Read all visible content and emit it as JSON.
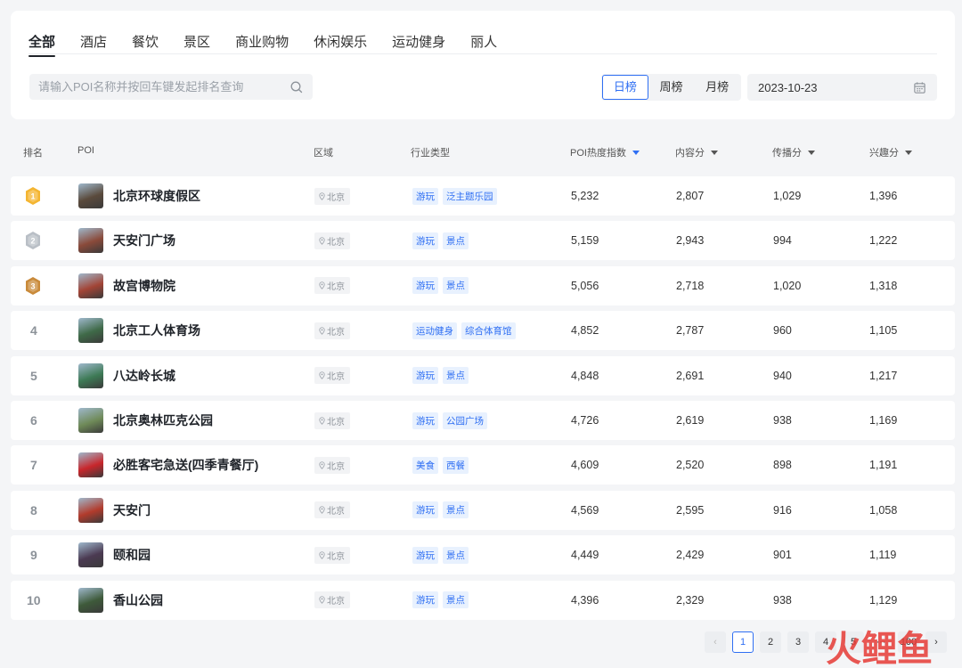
{
  "tabs": [
    {
      "label": "全部",
      "active": true
    },
    {
      "label": "酒店"
    },
    {
      "label": "餐饮"
    },
    {
      "label": "景区"
    },
    {
      "label": "商业购物"
    },
    {
      "label": "休闲娱乐"
    },
    {
      "label": "运动健身"
    },
    {
      "label": "丽人"
    }
  ],
  "search": {
    "placeholder": "请输入POI名称并按回车键发起排名查询",
    "value": ""
  },
  "period": {
    "options": [
      "日榜",
      "周榜",
      "月榜"
    ],
    "selected": "日榜"
  },
  "date": {
    "value": "2023-10-23"
  },
  "columns": {
    "rank": "排名",
    "poi": "POI",
    "region": "区域",
    "industry": "行业类型",
    "heat": "POI热度指数",
    "content": "内容分",
    "spread": "传播分",
    "interest": "兴趣分"
  },
  "sort_column": "heat",
  "rows": [
    {
      "rank": "1",
      "name": "北京环球度假区",
      "region": "北京",
      "tags": [
        "游玩",
        "泛主题乐园"
      ],
      "heat": "5,232",
      "content": "2,807",
      "spread": "1,029",
      "interest": "1,396",
      "thumb": "#5a4a3c"
    },
    {
      "rank": "2",
      "name": "天安门广场",
      "region": "北京",
      "tags": [
        "游玩",
        "景点"
      ],
      "heat": "5,159",
      "content": "2,943",
      "spread": "994",
      "interest": "1,222",
      "thumb": "#8a4a3a"
    },
    {
      "rank": "3",
      "name": "故宫博物院",
      "region": "北京",
      "tags": [
        "游玩",
        "景点"
      ],
      "heat": "5,056",
      "content": "2,718",
      "spread": "1,020",
      "interest": "1,318",
      "thumb": "#a24436"
    },
    {
      "rank": "4",
      "name": "北京工人体育场",
      "region": "北京",
      "tags": [
        "运动健身",
        "综合体育馆"
      ],
      "heat": "4,852",
      "content": "2,787",
      "spread": "960",
      "interest": "1,105",
      "thumb": "#3f6a48"
    },
    {
      "rank": "5",
      "name": "八达岭长城",
      "region": "北京",
      "tags": [
        "游玩",
        "景点"
      ],
      "heat": "4,848",
      "content": "2,691",
      "spread": "940",
      "interest": "1,217",
      "thumb": "#3d7a55"
    },
    {
      "rank": "6",
      "name": "北京奥林匹克公园",
      "region": "北京",
      "tags": [
        "游玩",
        "公园广场"
      ],
      "heat": "4,726",
      "content": "2,619",
      "spread": "938",
      "interest": "1,169",
      "thumb": "#6f8a58"
    },
    {
      "rank": "7",
      "name": "必胜客宅急送(四季青餐厅)",
      "region": "北京",
      "tags": [
        "美食",
        "西餐"
      ],
      "heat": "4,609",
      "content": "2,520",
      "spread": "898",
      "interest": "1,191",
      "thumb": "#c8262b"
    },
    {
      "rank": "8",
      "name": "天安门",
      "region": "北京",
      "tags": [
        "游玩",
        "景点"
      ],
      "heat": "4,569",
      "content": "2,595",
      "spread": "916",
      "interest": "1,058",
      "thumb": "#b23b2c"
    },
    {
      "rank": "9",
      "name": "颐和园",
      "region": "北京",
      "tags": [
        "游玩",
        "景点"
      ],
      "heat": "4,449",
      "content": "2,429",
      "spread": "901",
      "interest": "1,119",
      "thumb": "#4b3a52"
    },
    {
      "rank": "10",
      "name": "香山公园",
      "region": "北京",
      "tags": [
        "游玩",
        "景点"
      ],
      "heat": "4,396",
      "content": "2,329",
      "spread": "938",
      "interest": "1,129",
      "thumb": "#3e5a3a"
    }
  ],
  "pagination": {
    "prev": "‹",
    "pages": [
      "1",
      "2",
      "3",
      "4",
      "5"
    ],
    "ellipsis": "···",
    "last": "100",
    "next": "›",
    "current": "1"
  },
  "colors": {
    "accent": "#2f6ff3",
    "tag_bg": "#e8f1fe",
    "gold": "#f4b531",
    "silver": "#b9bfc6",
    "bronze": "#c98a3a",
    "watermark": "#e53935"
  },
  "watermark": {
    "text": "火鲤鱼"
  }
}
